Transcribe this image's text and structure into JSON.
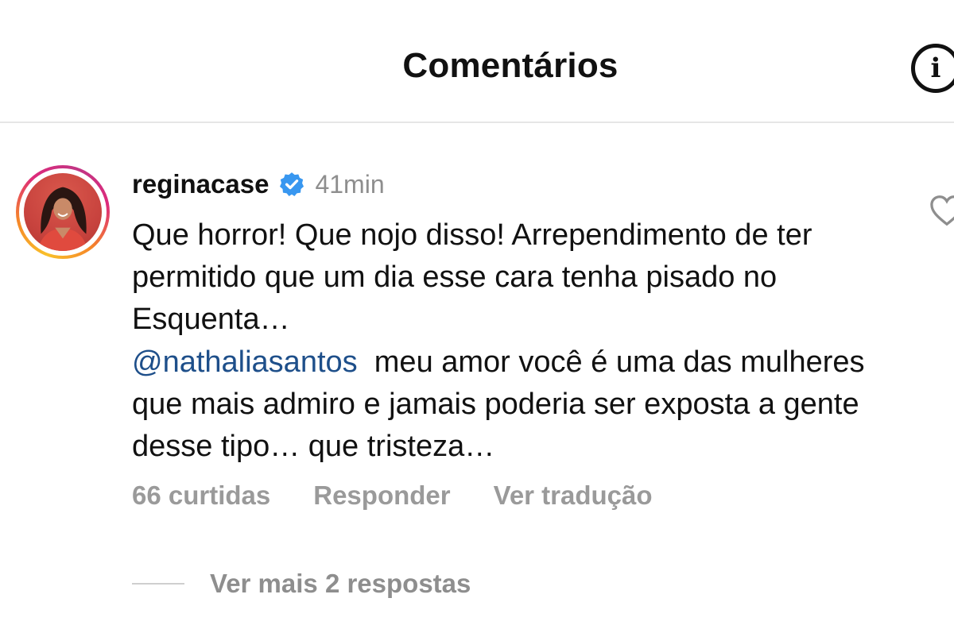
{
  "header": {
    "title": "Comentários",
    "info_icon": "info-icon"
  },
  "comment": {
    "username": "reginacase",
    "verified_icon": "verified-badge-icon",
    "verified_color": "#3897f0",
    "time": "41min",
    "text": "Que horror! Que nojo disso! Arrependimento de ter permitido que um dia esse cara tenha pisado no Esquenta…",
    "mention": "@nathaliasantos",
    "text_after_mention": "meu amor você é uma das mulheres que mais admiro e jamais poderia ser exposta a gente desse tipo… que tristeza…",
    "mention_color": "#1e4f8a",
    "like_icon": "heart-icon",
    "likes": "66 curtidas",
    "reply_label": "Responder",
    "translate_label": "Ver tradução",
    "more_replies": "Ver mais 2 respostas"
  }
}
